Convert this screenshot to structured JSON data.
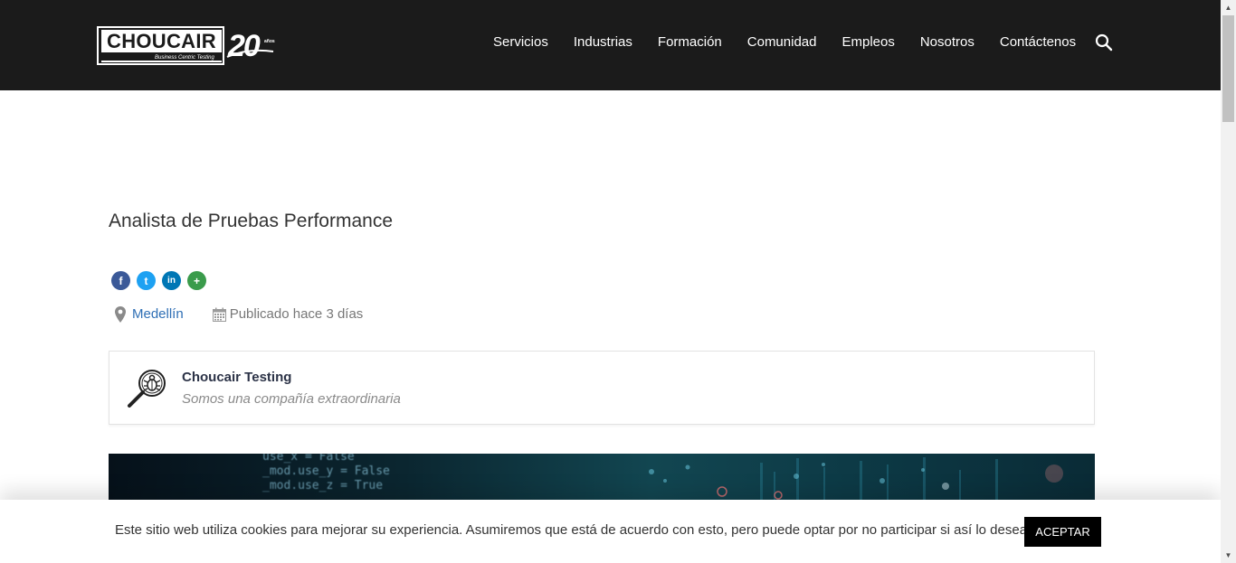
{
  "header": {
    "logo": {
      "brand": "CHOUCAIR",
      "tagline": "Business Centric Testing",
      "anniversary": "20",
      "anniversary_note": "años"
    },
    "nav": [
      {
        "label": "Servicios"
      },
      {
        "label": "Industrias"
      },
      {
        "label": "Formación"
      },
      {
        "label": "Comunidad"
      },
      {
        "label": "Empleos"
      },
      {
        "label": "Nosotros"
      },
      {
        "label": "Contáctenos"
      }
    ],
    "search_icon": "search-icon"
  },
  "job": {
    "title": "Analista de Pruebas Performance",
    "share": [
      {
        "icon": "facebook-icon",
        "glyph": "f",
        "color": "#3b5998"
      },
      {
        "icon": "twitter-icon",
        "glyph": "t",
        "color": "#1da1f2"
      },
      {
        "icon": "linkedin-icon",
        "glyph": "in",
        "color": "#0077b5"
      },
      {
        "icon": "more-share-icon",
        "glyph": "+",
        "color": "#3a9b4b"
      }
    ],
    "location": "Medellín",
    "posted": "Publicado hace 3 días"
  },
  "company": {
    "name": "Choucair Testing",
    "tagline": "Somos una compañía extraordinaria"
  },
  "banner": {
    "code_lines": [
      "use_x = False",
      "_mod.use_y = False",
      "_mod.use_z = True"
    ]
  },
  "cookie": {
    "text": "Este sitio web utiliza cookies para mejorar su experiencia. Asumiremos que está de acuerdo con esto, pero puede optar por no participar si así lo desea.",
    "accept_label": "ACEPTAR"
  },
  "colors": {
    "header_bg": "#1b1b1b",
    "link": "#2f6fb5",
    "accept_bg": "#000000"
  }
}
